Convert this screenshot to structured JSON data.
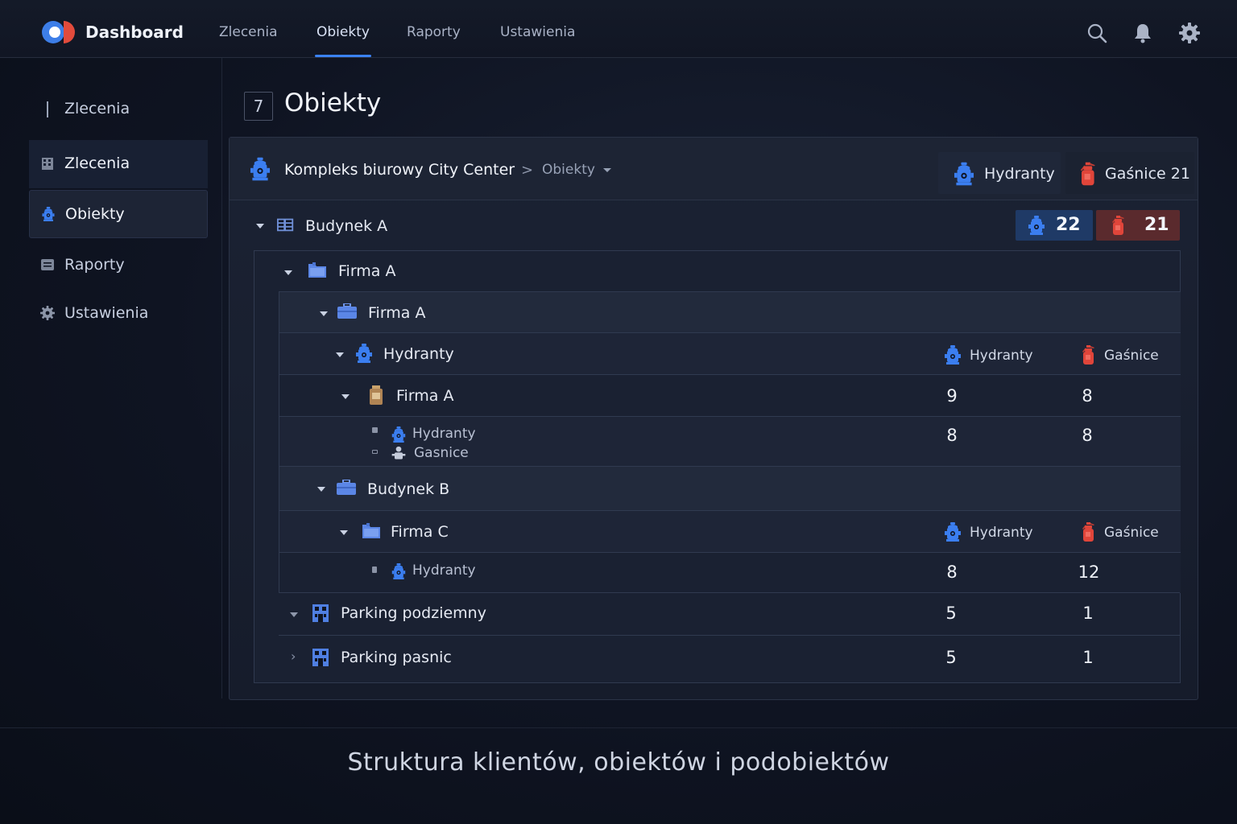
{
  "app": {
    "brand": "Dashboard"
  },
  "nav": {
    "tabs": [
      {
        "label": "Zlecenia",
        "active": false
      },
      {
        "label": "Obiekty",
        "active": true
      },
      {
        "label": "Raporty",
        "active": false
      },
      {
        "label": "Ustawienia",
        "active": false
      }
    ],
    "icons": [
      "search-icon",
      "bell-icon",
      "gear-icon"
    ]
  },
  "sidebar": {
    "items": [
      {
        "label": "Zlecenia",
        "icon": "bar-icon"
      },
      {
        "label": "Zlecenia",
        "icon": "building-icon"
      },
      {
        "label": "Obiekty",
        "icon": "hydrant-icon"
      },
      {
        "label": "Raporty",
        "icon": "document-icon"
      },
      {
        "label": "Ustawienia",
        "icon": "gear-icon"
      }
    ]
  },
  "page": {
    "number": "7",
    "title": "Obiekty"
  },
  "breadcrumb": {
    "main": "Kompleks biurowy City Center",
    "separator": ">",
    "sub": "Obiekty"
  },
  "summary": {
    "hydranty_label": "Hydranty",
    "gasnice_label": "Gaśnice 21"
  },
  "tree": {
    "building_a": {
      "label": "Budynek A",
      "hydranty": "22",
      "gasnice": "21"
    },
    "firma_a_1": {
      "label": "Firma A"
    },
    "firma_a_2": {
      "label": "Firma A"
    },
    "hydranty_group": {
      "label": "Hydranty",
      "col_hydranty": "Hydranty",
      "col_gasnice": "Gaśnice"
    },
    "firma_a_3": {
      "label": "Firma A",
      "hydranty": "9",
      "gasnice": "8"
    },
    "sub_items": {
      "label1": "Hydranty",
      "label2": "Gasnice",
      "hydranty": "8",
      "gasnice": "8"
    },
    "building_b": {
      "label": "Budynek B"
    },
    "firma_c": {
      "label": "Firma C",
      "col_hydranty": "Hydranty",
      "col_gasnice": "Gaśnice"
    },
    "firma_c_hydranty": {
      "label": "Hydranty",
      "hydranty": "8",
      "gasnice": "12"
    },
    "parking_podziemny": {
      "label": "Parking podziemny",
      "hydranty": "5",
      "gasnice": "1"
    },
    "parking_pasnic": {
      "label": "Parking pasnic",
      "hydranty": "5",
      "gasnice": "1"
    }
  },
  "caption": "Struktura klientów, obiektów i podobiektów",
  "colors": {
    "accent": "#3b82f6",
    "hydrant": "#3b7ef0",
    "extinguisher": "#e0453a",
    "background": "#0f1422"
  }
}
